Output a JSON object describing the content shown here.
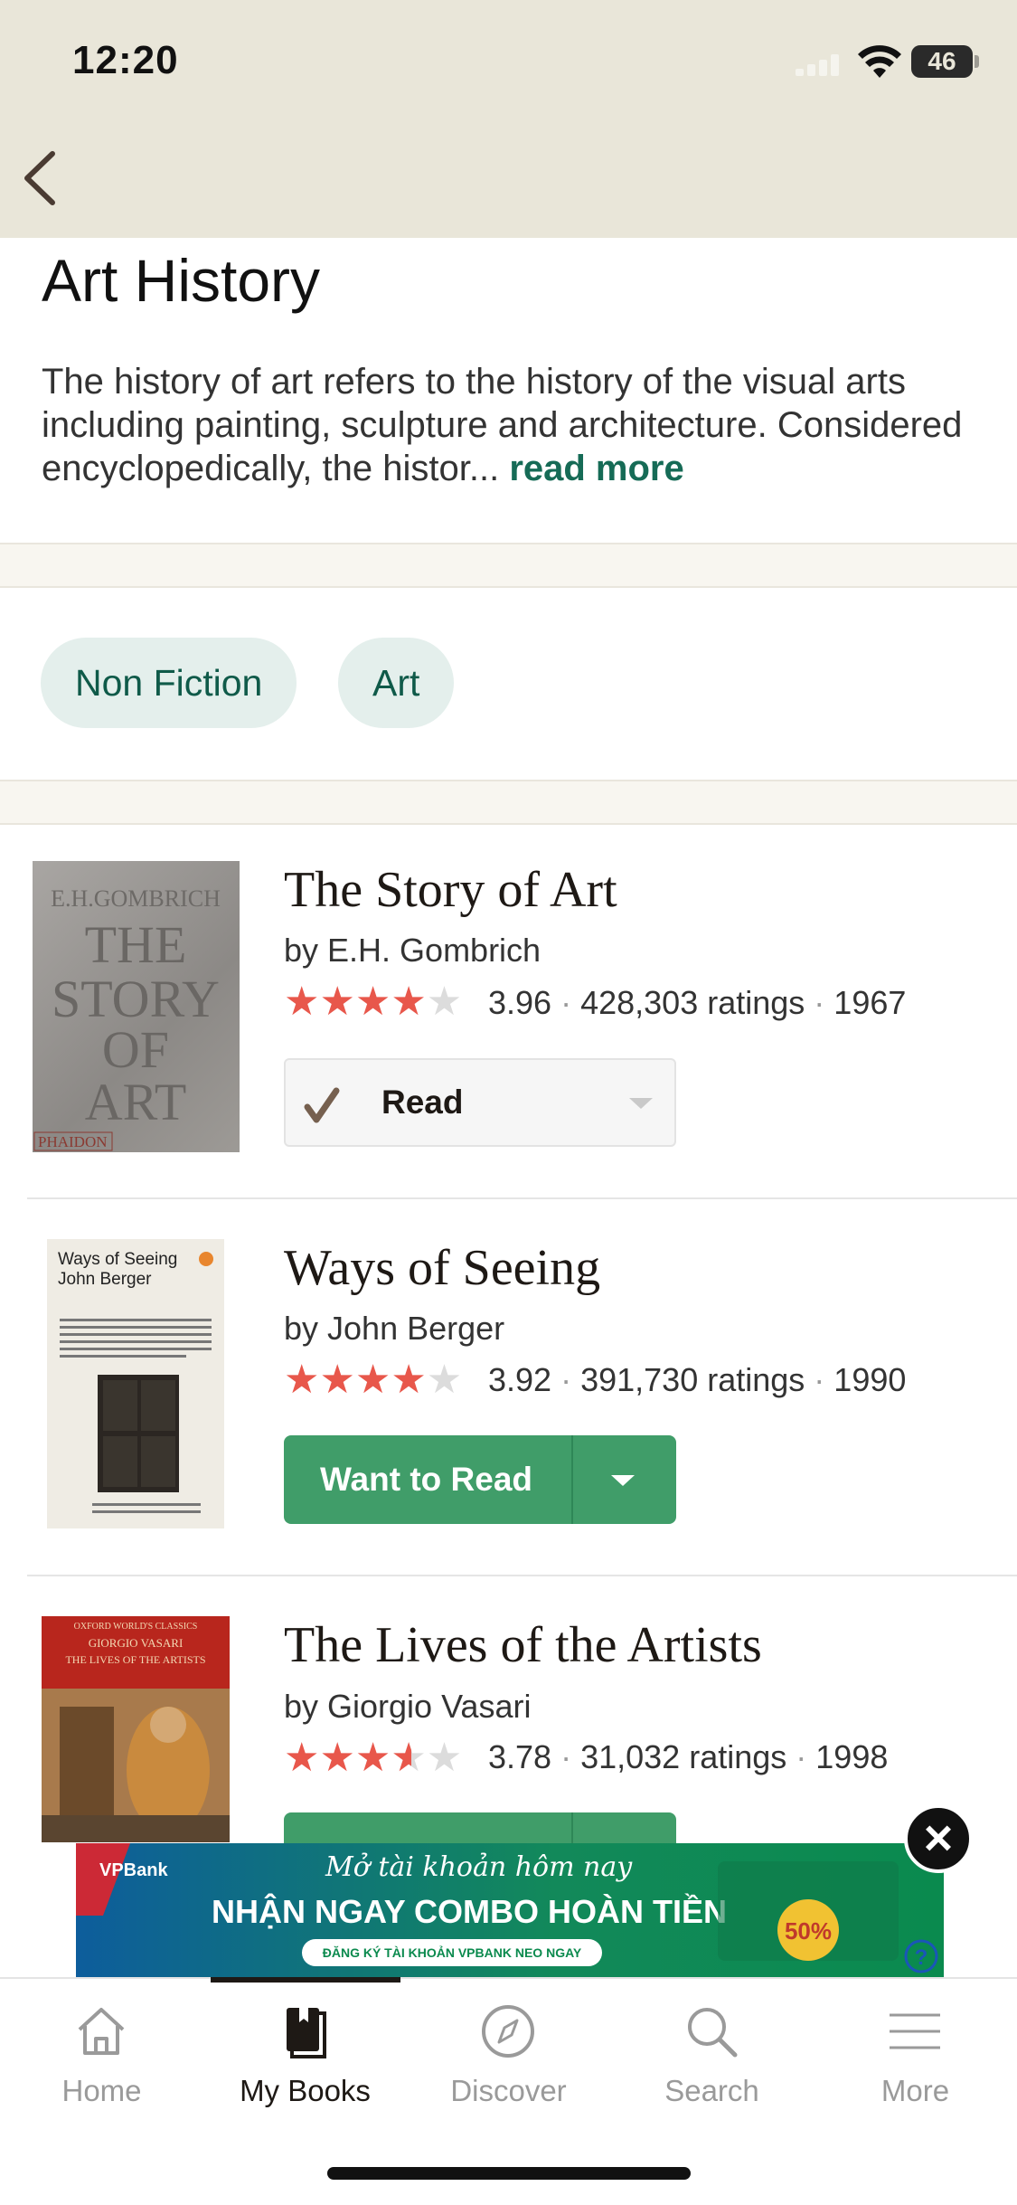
{
  "status_bar": {
    "time": "12:20",
    "battery": "46"
  },
  "header": {
    "title": "Art History",
    "description": "The history of art refers to the history of the visual arts including painting, sculpture and architecture. Considered encyclopedically, the histor...",
    "read_more": "read more"
  },
  "genres": [
    "Non Fiction",
    "Art"
  ],
  "books": [
    {
      "title": "The Story of Art",
      "author": "by E.H. Gombrich",
      "rating": "3.96",
      "ratings_count": "428,303 ratings",
      "year": "1967",
      "rating_value": 3.96,
      "shelf_status": "Read",
      "cover_text": [
        "E.H.GOMBRICH",
        "THE",
        "STORY",
        "OF",
        "ART",
        "PHAIDON"
      ]
    },
    {
      "title": "Ways of Seeing",
      "author": "by John Berger",
      "rating": "3.92",
      "ratings_count": "391,730 ratings",
      "year": "1990",
      "rating_value": 3.92,
      "shelf_action": "Want to Read",
      "cover_text": [
        "Ways of Seeing",
        "John Berger"
      ]
    },
    {
      "title": "The Lives of the Artists",
      "author": "by Giorgio Vasari",
      "rating": "3.78",
      "ratings_count": "31,032 ratings",
      "year": "1998",
      "rating_value": 3.78,
      "cover_text": [
        "OXFORD WORLD'S CLASSICS",
        "GIORGIO VASARI",
        "THE LIVES OF THE ARTISTS"
      ]
    }
  ],
  "ad": {
    "brand": "VPBank",
    "headline_script": "Mở tài khoản hôm nay",
    "headline": "NHẬN NGAY COMBO HOÀN TIỀN",
    "cta": "ĐĂNG KÝ TÀI KHOẢN VPBANK NEO NGAY",
    "badge": "50%"
  },
  "tabs": [
    {
      "label": "Home",
      "icon": "home-icon"
    },
    {
      "label": "My Books",
      "icon": "book-icon",
      "active": true
    },
    {
      "label": "Discover",
      "icon": "compass-icon"
    },
    {
      "label": "Search",
      "icon": "search-icon"
    },
    {
      "label": "More",
      "icon": "menu-icon"
    }
  ],
  "colors": {
    "topbar": "#e9e6d9",
    "accent_green": "#409d69",
    "link_green": "#166b56",
    "star": "#e8574b"
  }
}
